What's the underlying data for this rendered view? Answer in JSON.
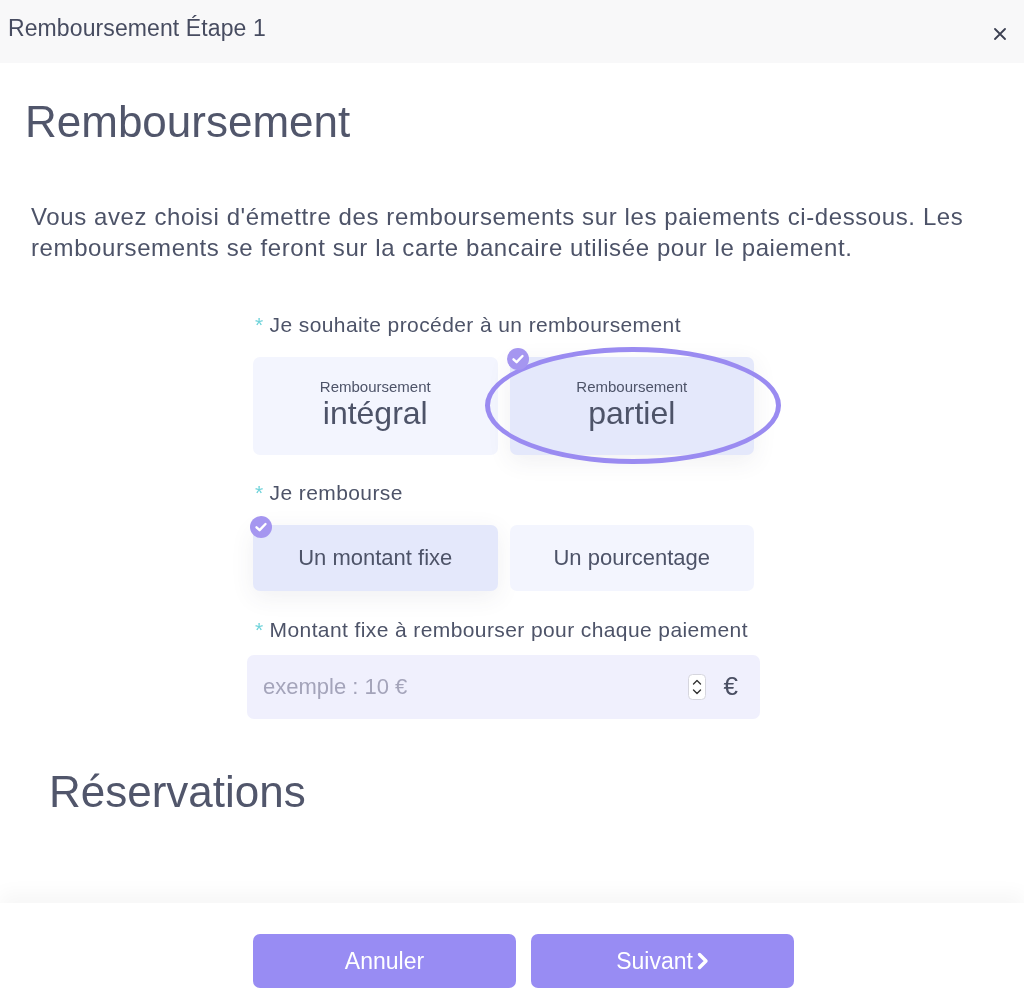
{
  "dialog": {
    "title": "Remboursement Étape 1"
  },
  "heading": "Remboursement",
  "intro": "Vous avez choisi d'émettre des remboursements sur les paiements ci-dessous. Les remboursements se feront sur la carte bancaire utilisée pour le paiement.",
  "refund_type": {
    "required_mark": "*",
    "label": "Je souhaite procéder à un remboursement",
    "options": [
      {
        "caption": "Remboursement",
        "value": "intégral",
        "selected": false,
        "highlighted": false
      },
      {
        "caption": "Remboursement",
        "value": "partiel",
        "selected": true,
        "highlighted": true
      }
    ]
  },
  "refund_mode": {
    "required_mark": "*",
    "label": "Je rembourse",
    "options": [
      {
        "label": "Un montant fixe",
        "selected": true
      },
      {
        "label": "Un pourcentage",
        "selected": false
      }
    ]
  },
  "amount": {
    "required_mark": "*",
    "label": "Montant fixe à rembourser pour chaque paiement",
    "placeholder": "exemple : 10 €",
    "unit": "€"
  },
  "section_heading": "Réservations",
  "buttons": [
    {
      "label": "Annuler",
      "kind": "cancel"
    },
    {
      "label": "Suivant",
      "kind": "next"
    }
  ]
}
